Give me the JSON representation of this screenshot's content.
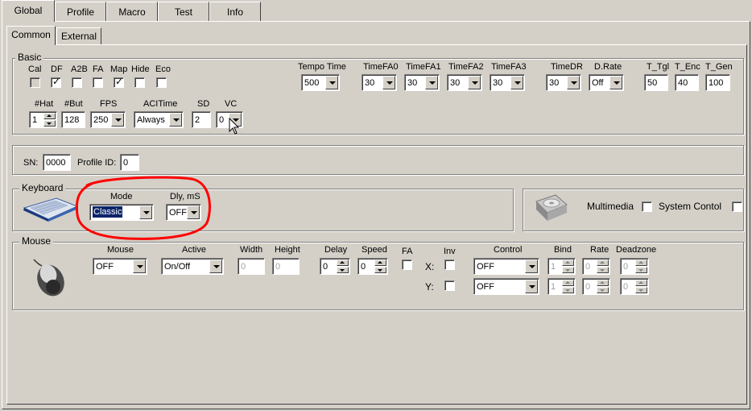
{
  "colors": {
    "window_bg": "#d4d0c8",
    "selection": "#0a246a",
    "annotation": "#ff0000"
  },
  "main_tabs": [
    "Global",
    "Profile",
    "Macro",
    "Test",
    "Info"
  ],
  "sub_tabs": [
    "Common",
    "External"
  ],
  "basic": {
    "title": "Basic",
    "checks": [
      {
        "label": "Cal",
        "checked": false,
        "disabled": true
      },
      {
        "label": "DF",
        "checked": true,
        "disabled": false
      },
      {
        "label": "A2B",
        "checked": false,
        "disabled": false
      },
      {
        "label": "FA",
        "checked": false,
        "disabled": false
      },
      {
        "label": "Map",
        "checked": true,
        "disabled": false
      },
      {
        "label": "Hide",
        "checked": false,
        "disabled": false
      },
      {
        "label": "Eco",
        "checked": false,
        "disabled": false
      }
    ],
    "tempo_time": {
      "label": "Tempo Time",
      "value": "500"
    },
    "time_fa": [
      {
        "label": "TimeFA0",
        "value": "30"
      },
      {
        "label": "TimeFA1",
        "value": "30"
      },
      {
        "label": "TimeFA2",
        "value": "30"
      },
      {
        "label": "TimeFA3",
        "value": "30"
      }
    ],
    "time_dr": {
      "label": "TimeDR",
      "value": "30"
    },
    "d_rate": {
      "label": "D.Rate",
      "value": "Off"
    },
    "t_tgl": {
      "label": "T_Tgl",
      "value": "50"
    },
    "t_enc": {
      "label": "T_Enc",
      "value": "40"
    },
    "t_gen": {
      "label": "T_Gen",
      "value": "100"
    },
    "hat": {
      "label": "#Hat",
      "value": "1"
    },
    "but": {
      "label": "#But",
      "value": "128"
    },
    "fps": {
      "label": "FPS",
      "value": "250"
    },
    "acitime": {
      "label": "ACITime",
      "value": "Always"
    },
    "sd": {
      "label": "SD",
      "value": "2"
    },
    "vc": {
      "label": "VC",
      "value": "0"
    }
  },
  "sn": {
    "label": "SN:",
    "value": "0000"
  },
  "profile_id": {
    "label": "Profile ID:",
    "value": "0"
  },
  "keyboard": {
    "title": "Keyboard",
    "mode": {
      "label": "Mode",
      "value": "Classic"
    },
    "dly": {
      "label": "Dly, mS",
      "value": "OFF"
    }
  },
  "multimedia": {
    "label": "Multimedia",
    "checked": false
  },
  "system_control": {
    "label": "System Contol",
    "checked": false
  },
  "mouse": {
    "title": "Mouse",
    "headers": {
      "mouse": "Mouse",
      "active": "Active",
      "width": "Width",
      "height": "Height",
      "delay": "Delay",
      "speed": "Speed",
      "fa": "FA",
      "inv": "Inv",
      "control": "Control",
      "bind": "Bind",
      "rate": "Rate",
      "deadzone": "Deadzone"
    },
    "mouse_value": "OFF",
    "active_value": "On/Off",
    "width_value": "0",
    "height_value": "0",
    "delay_value": "0",
    "speed_value": "0",
    "x_label": "X:",
    "y_label": "Y:",
    "rows": [
      {
        "control": "OFF",
        "bind": "1",
        "rate": "0",
        "deadzone": "0"
      },
      {
        "control": "OFF",
        "bind": "1",
        "rate": "0",
        "deadzone": "0"
      }
    ]
  }
}
